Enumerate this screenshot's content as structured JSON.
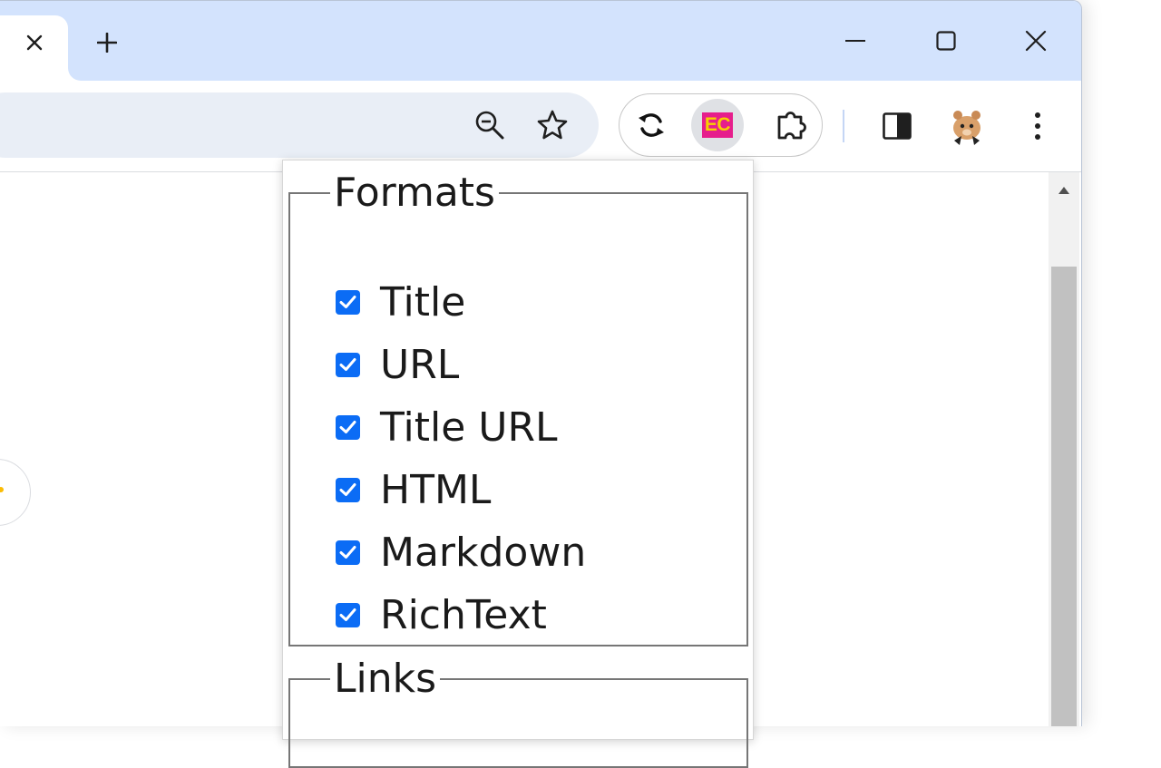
{
  "browser": {
    "tab_close_icon": "close-icon",
    "new_tab_icon": "plus-icon",
    "window_controls": [
      "minimize-icon",
      "maximize-icon",
      "close-icon"
    ],
    "omnibox_icons": [
      "zoom-out-icon",
      "star-icon"
    ],
    "extensions": [
      {
        "name": "sync-extension",
        "icon": "sync-icon"
      },
      {
        "name": "ec-extension",
        "icon": "ec-logo",
        "badge_text": "EC",
        "badge_bg": "#e61e8c",
        "badge_fg": "#f7d000",
        "active": true
      },
      {
        "name": "extensions-menu",
        "icon": "puzzle-icon"
      }
    ],
    "toolbar_icons": [
      "side-panel-icon",
      "avatar",
      "kebab-menu-icon"
    ]
  },
  "popup": {
    "formats": {
      "legend": "Formats",
      "options": [
        {
          "label": "Title",
          "checked": true
        },
        {
          "label": "URL",
          "checked": true
        },
        {
          "label": "Title URL",
          "checked": true
        },
        {
          "label": "HTML",
          "checked": true
        },
        {
          "label": "Markdown",
          "checked": true
        },
        {
          "label": "RichText",
          "checked": true
        }
      ]
    },
    "links": {
      "legend": "Links"
    }
  },
  "colors": {
    "tabstrip": "#d3e3fd",
    "omnibox": "#e9eef6",
    "checkbox": "#0b6cf5"
  }
}
